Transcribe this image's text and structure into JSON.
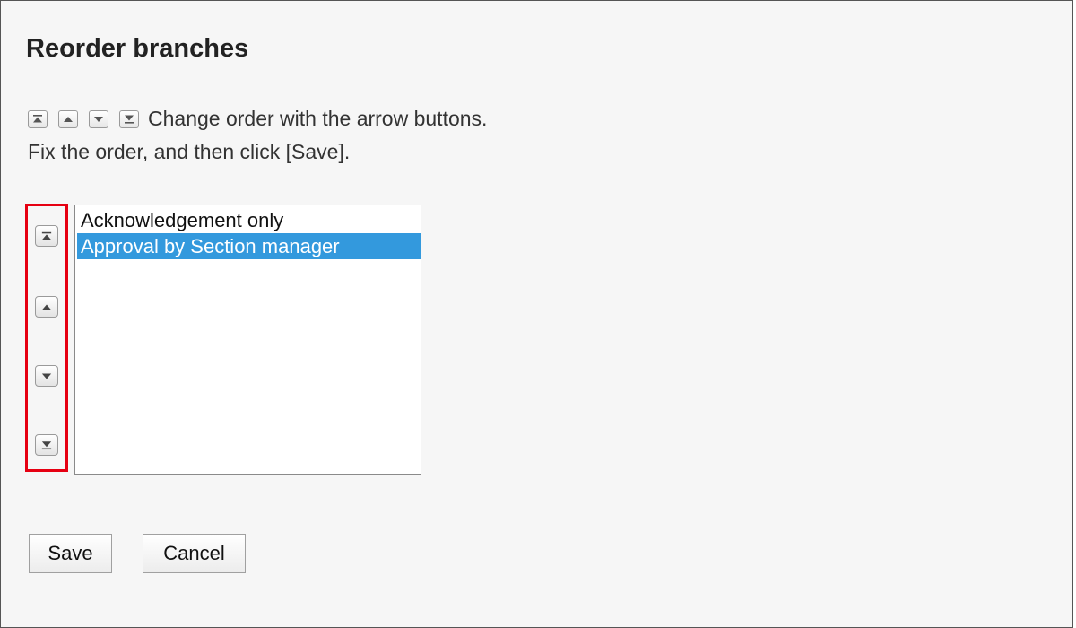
{
  "page": {
    "title": "Reorder branches"
  },
  "instructions": {
    "line1": "Change order with the arrow buttons.",
    "line2": "Fix the order, and then click [Save].",
    "icons": [
      "move-to-top-icon",
      "move-up-icon",
      "move-down-icon",
      "move-to-bottom-icon"
    ]
  },
  "listbox": {
    "options": [
      {
        "label": "Acknowledgement only",
        "selected": false
      },
      {
        "label": "Approval by Section manager",
        "selected": true
      }
    ]
  },
  "side_buttons": {
    "icons": [
      "move-to-top-icon",
      "move-up-icon",
      "move-down-icon",
      "move-to-bottom-icon"
    ],
    "highlight_color": "#e60012"
  },
  "actions": {
    "save_label": "Save",
    "cancel_label": "Cancel"
  },
  "colors": {
    "selection": "#3399dd",
    "highlight": "#e60012"
  }
}
